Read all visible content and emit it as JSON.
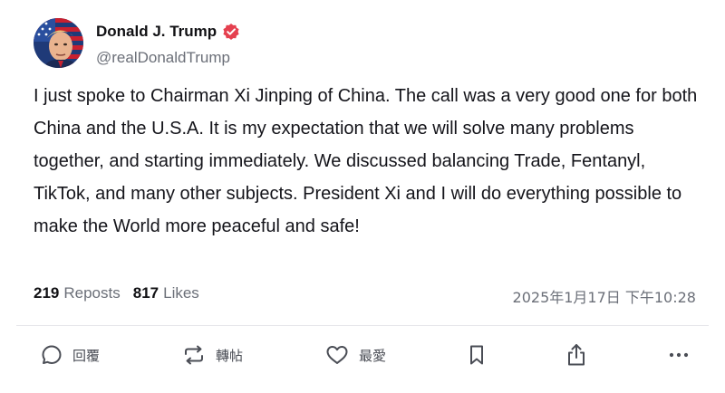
{
  "post": {
    "author": {
      "display_name": "Donald J. Trump",
      "handle": "@realDonaldTrump",
      "verified": true,
      "verified_color": "#e5404f"
    },
    "text": "I just spoke to Chairman Xi Jinping of China. The call was a very good one for both China and the U.S.A. It is my expectation that we will solve many problems together, and starting immediately. We discussed balancing Trade, Fentanyl, TikTok, and many other subjects. President Xi and I will do everything possible to make the World more peaceful and safe!",
    "stats": {
      "reposts_count": "219",
      "reposts_label": "Reposts",
      "likes_count": "817",
      "likes_label": "Likes"
    },
    "timestamp": "2025年1月17日 下午10:28"
  },
  "actions": {
    "reply": {
      "label": "回覆",
      "icon": "reply-icon"
    },
    "repost": {
      "label": "轉帖",
      "icon": "repost-icon"
    },
    "like": {
      "label": "最愛",
      "icon": "heart-icon"
    },
    "bookmark": {
      "icon": "bookmark-icon"
    },
    "share": {
      "icon": "share-icon"
    },
    "more": {
      "icon": "more-icon"
    }
  },
  "colors": {
    "text_primary": "#111114",
    "text_secondary": "#6b6f78",
    "divider": "#e6e6ea",
    "icon": "#4a4d55"
  }
}
